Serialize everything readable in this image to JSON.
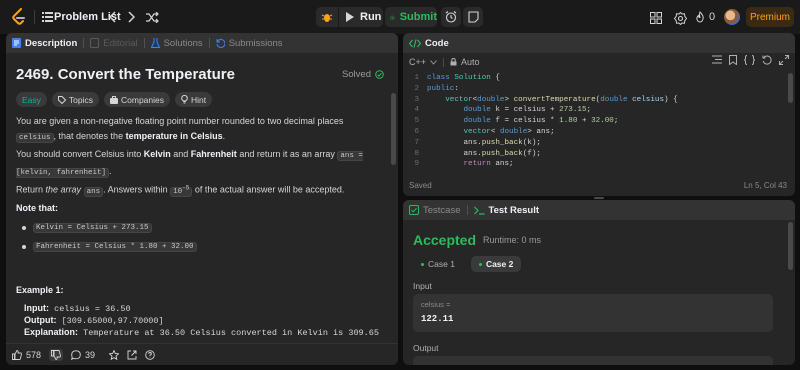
{
  "nav": {
    "problem_list": "Problem List",
    "run": "Run",
    "submit": "Submit",
    "streak_count": "0",
    "premium": "Premium"
  },
  "left_tabs": {
    "description": "Description",
    "editorial": "Editorial",
    "solutions": "Solutions",
    "submissions": "Submissions"
  },
  "problem": {
    "title": "2469. Convert the Temperature",
    "solved": "Solved",
    "chips": {
      "difficulty": "Easy",
      "topics": "Topics",
      "companies": "Companies",
      "hint": "Hint"
    },
    "p1_a": "You are given a non-negative floating point number rounded to two decimal places ",
    "p1_code": "celsius",
    "p1_b": ", that denotes the ",
    "p1_bold": "temperature in Celsius",
    "p1_c": ".",
    "p2_a": "You should convert Celsius into ",
    "p2_kelvin": "Kelvin",
    "p2_and": " and ",
    "p2_fahr": "Fahrenheit",
    "p2_b": " and return it as an array ",
    "p2_code": "ans = [kelvin, fahrenheit]",
    "p2_c": ".",
    "p3_a": "Return ",
    "p3_em": "the array",
    "p3_code": "ans",
    "p3_b": ". Answers within ",
    "p3_code2": "10",
    "p3_sup": "-5",
    "p3_c": " of the actual answer will be accepted.",
    "note_title": "Note that:",
    "bullets": [
      "Kelvin = Celsius + 273.15",
      "Fahrenheit = Celsius * 1.80 + 32.00"
    ],
    "example_title": "Example 1:",
    "ex_input_label": "Input:",
    "ex_input": " celsius = 36.50",
    "ex_output_label": "Output:",
    "ex_output": " [309.65000,97.70000]",
    "ex_expl_label": "Explanation:",
    "ex_expl": " Temperature at 36.50 Celsius converted in Kelvin is 309.65",
    "likes": "578",
    "comments": "39"
  },
  "code": {
    "tab": "Code",
    "language": "C++",
    "mode": "Auto",
    "lines": [
      "class Solution {",
      "public:",
      "    vector<double> convertTemperature(double celsius) {",
      "        double k = celsius + 273.15;",
      "        double f = celsius * 1.80 + 32.00;",
      "        vector< double> ans;",
      "        ans.push_back(k);",
      "        ans.push_back(f);",
      "        return ans;"
    ],
    "saved": "Saved",
    "cursor": "Ln 5, Col 43"
  },
  "test": {
    "tab_testcase": "Testcase",
    "tab_result": "Test Result",
    "status": "Accepted",
    "runtime": "Runtime: 0 ms",
    "cases": [
      "Case 1",
      "Case 2"
    ],
    "input_label": "Input",
    "var_name": "celsius =",
    "var_value": "122.11",
    "output_label": "Output"
  },
  "colors": {
    "accent_green": "#2cbb5d",
    "premium_orange": "#ffa116",
    "easy_teal": "#00b8a3",
    "keyword_blue": "#569cd6",
    "type_teal": "#4ec9b0",
    "number_green": "#b5cea8"
  }
}
